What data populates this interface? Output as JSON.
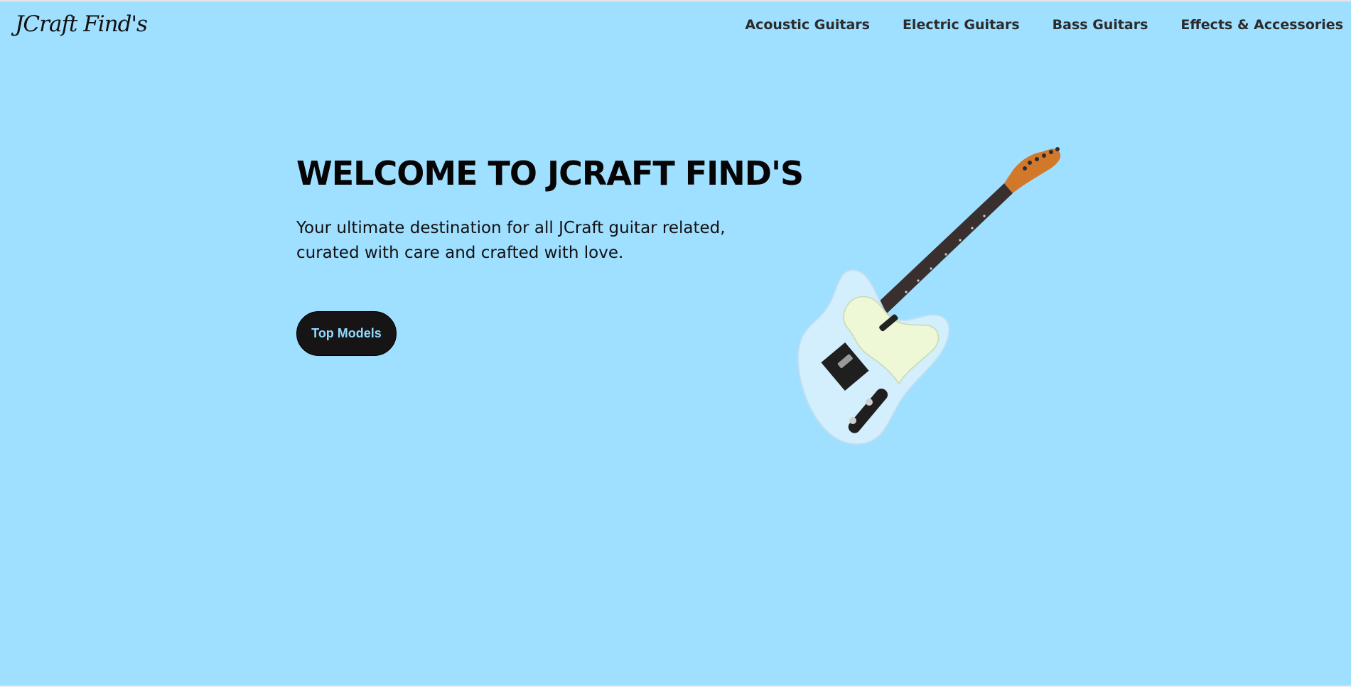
{
  "brand": {
    "logo_text": "JCraft Find's"
  },
  "nav": {
    "links": [
      {
        "label": "Acoustic Guitars"
      },
      {
        "label": "Electric Guitars"
      },
      {
        "label": "Bass Guitars"
      },
      {
        "label": "Effects & Accessories"
      }
    ]
  },
  "hero": {
    "title": "WELCOME TO JCRAFT FIND'S",
    "subtitle_line1": "Your ultimate destination for all JCraft guitar related,",
    "subtitle_line2": "curated with care and crafted with love.",
    "cta_label": "Top Models"
  },
  "colors": {
    "background": "#9fdfff",
    "button_bg": "#161414",
    "button_text": "#8fd9ff",
    "guitar_body": "#d3eefc",
    "pickguard": "#eef8d6",
    "headstock": "#d2782a",
    "fretboard": "#3a2f2f"
  },
  "image": {
    "hero_icon": "electric-guitar-image"
  }
}
